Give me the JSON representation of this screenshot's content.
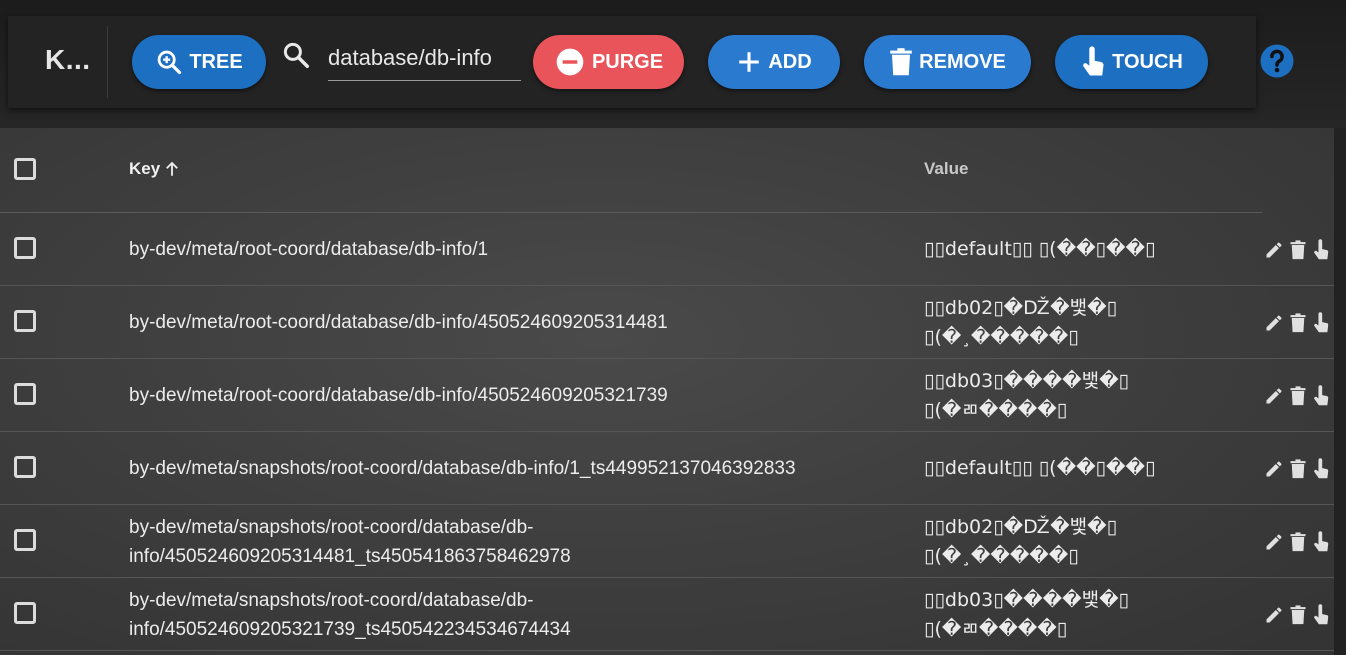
{
  "header": {
    "app_title": "K...",
    "search": {
      "value": "database/db-info",
      "placeholder": ""
    },
    "buttons": {
      "tree": "TREE",
      "purge": "PURGE",
      "add": "ADD",
      "remove": "REMOVE",
      "touch": "TOUCH"
    },
    "help_icon": "help-circle-icon"
  },
  "table": {
    "columns": {
      "key": "Key",
      "value": "Value"
    },
    "sort": {
      "column": "Key",
      "direction": "ascending"
    },
    "rows": [
      {
        "key": "by-dev/meta/root-coord/database/db-info/1",
        "value": "▯▯default▯▯ ▯(��▯��▯"
      },
      {
        "key": "by-dev/meta/root-coord/database/db-info/450524609205314481",
        "value": "▯▯db02▯�Ǆ�뱇�▯\n▯(�¸�����▯"
      },
      {
        "key": "by-dev/meta/root-coord/database/db-info/450524609205321739",
        "value": "▯▯db03▯����뱇�▯\n▯(�ㄻ����▯"
      },
      {
        "key": "by-dev/meta/snapshots/root-coord/database/db-info/1_ts449952137046392833",
        "value": "▯▯default▯▯ ▯(��▯��▯"
      },
      {
        "key": "by-dev/meta/snapshots/root-coord/database/db-info/450524609205314481_ts450541863758462978",
        "value": "▯▯db02▯�Ǆ�뱇�▯\n▯(�¸�����▯"
      },
      {
        "key": "by-dev/meta/snapshots/root-coord/database/db-info/450524609205321739_ts450542234534674434",
        "value": "▯▯db03▯����뱇�▯\n▯(�ㄻ����▯"
      }
    ],
    "row_actions": [
      "pencil-icon",
      "trash-icon",
      "touch-icon"
    ]
  },
  "colors": {
    "primary": "#1d6fc2",
    "danger": "#e8545a",
    "background": "#222222"
  }
}
